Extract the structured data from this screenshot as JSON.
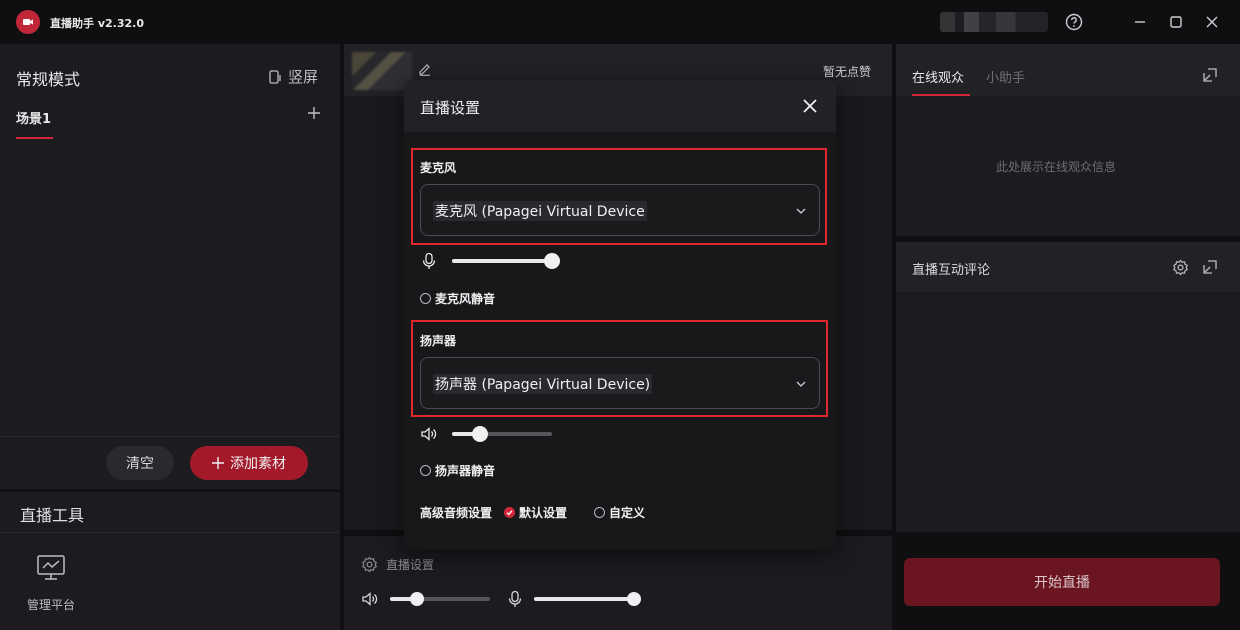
{
  "app": {
    "title": "直播助手 v2.32.0"
  },
  "left": {
    "mode_title": "常规模式",
    "vertical_label": "竖屏",
    "scene_tab": "场景1",
    "clear_label": "清空",
    "add_material_label": "添加素材",
    "tools_title": "直播工具",
    "tools": [
      {
        "label": "管理平台",
        "icon": "monitor-chart-icon"
      }
    ]
  },
  "center": {
    "likes_text": "暂无点赞",
    "live_settings_label": "直播设置",
    "speaker_volume": 0.27,
    "mic_volume": 1.0
  },
  "right": {
    "tabs": [
      "在线观众",
      "小助手"
    ],
    "empty_text": "此处展示在线观众信息",
    "comments_title": "直播互动评论",
    "start_label": "开始直播"
  },
  "modal": {
    "title": "直播设置",
    "mic": {
      "label": "麦克风",
      "device": "麦克风 (Papagei Virtual Device",
      "volume": 1.0,
      "mute_label": "麦克风静音"
    },
    "speaker": {
      "label": "扬声器",
      "device": "扬声器 (Papagei Virtual Device)",
      "volume": 0.28,
      "mute_label": "扬声器静音"
    },
    "advanced": {
      "label": "高级音频设置",
      "options": [
        "默认设置",
        "自定义"
      ],
      "selected": "默认设置"
    }
  },
  "colors": {
    "accent": "#d0283a",
    "highlight_box": "#e0282e",
    "background": "#0f0f11",
    "panel": "#1c1c20"
  }
}
